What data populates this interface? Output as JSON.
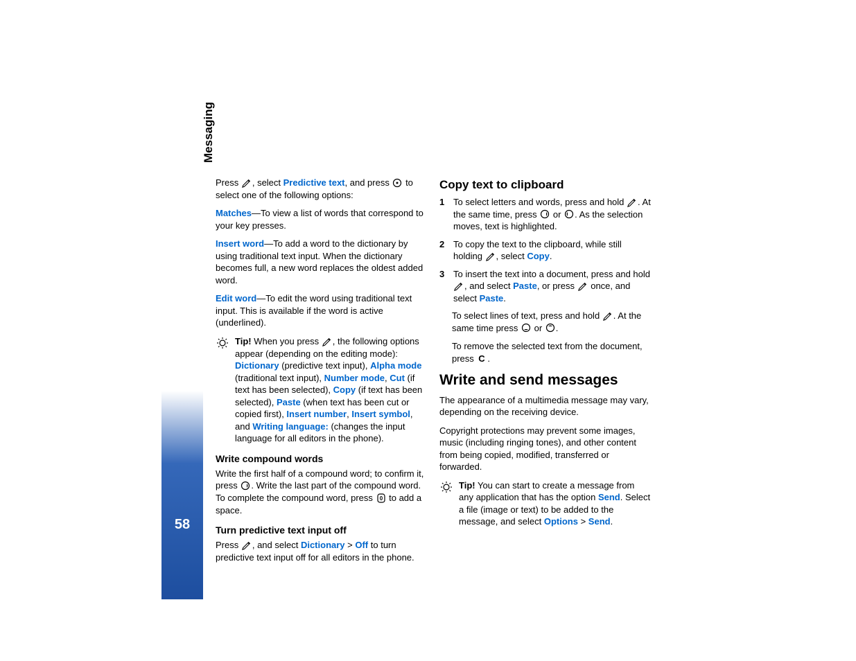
{
  "sidebar": {
    "section": "Messaging",
    "page_number": "58"
  },
  "col1": {
    "p1_a": "Press ",
    "p1_b": ", select ",
    "p1_link1": "Predictive text",
    "p1_c": ", and press ",
    "p1_d": " to select one of the following options:",
    "matches_label": "Matches",
    "matches_text": "—To view a list of words that correspond to your key presses.",
    "insert_word_label": "Insert word",
    "insert_word_text": "—To add a word to the dictionary by using traditional text input. When the dictionary becomes full, a new word replaces the oldest added word.",
    "edit_word_label": "Edit word",
    "edit_word_text": "—To edit the word using traditional text input. This is available if the word is active (underlined).",
    "tip_label": "Tip!",
    "tip1_a": " When you press ",
    "tip1_b": ", the following options appear (depending on the editing mode): ",
    "tip1_dict": "Dictionary",
    "tip1_c": " (predictive text input), ",
    "tip1_alpha": "Alpha mode",
    "tip1_d": " (traditional text input), ",
    "tip1_number": "Number mode",
    "tip1_sep1": ", ",
    "tip1_cut": "Cut",
    "tip1_e": " (if text has been selected), ",
    "tip1_copy": "Copy",
    "tip1_f": " (if text has been selected), ",
    "tip1_paste": "Paste",
    "tip1_g": " (when text has been cut or copied first), ",
    "tip1_insnum": "Insert number",
    "tip1_sep2": ", ",
    "tip1_inssym": "Insert symbol",
    "tip1_h": ", and ",
    "tip1_wlang": "Writing language:",
    "tip1_i": " (changes the input language for all editors in the phone).",
    "sub1": "Write compound words",
    "p2_a": "Write the first half of a compound word; to confirm it, press ",
    "p2_b": ". Write the last part of the compound word. To complete the compound word, press ",
    "p2_c": " to add a space.",
    "sub2": "Turn predictive text input off",
    "p3_a": "Press ",
    "p3_b": ", and select ",
    "p3_dict": "Dictionary",
    "p3_gt": " > ",
    "p3_off": "Off",
    "p3_c": " to turn predictive text input off for all editors in the phone."
  },
  "col2": {
    "h2": "Copy text to clipboard",
    "n1": "1",
    "li1_a": "To select letters and words, press and hold ",
    "li1_b": ". At the same time, press ",
    "li1_c": " or ",
    "li1_d": ". As the selection moves, text is highlighted.",
    "n2": "2",
    "li2_a": "To copy the text to the clipboard, while still holding ",
    "li2_b": ", select ",
    "li2_copy": "Copy",
    "li2_c": ".",
    "n3": "3",
    "li3_a": "To insert the text into a document, press and hold ",
    "li3_b": ", and select ",
    "li3_paste": "Paste",
    "li3_c": ", or press ",
    "li3_d": " once, and select ",
    "li3_paste2": "Paste",
    "li3_e": ".",
    "p4_a": "To select lines of text, press and hold ",
    "p4_b": ". At the same time press ",
    "p4_c": " or ",
    "p4_d": ".",
    "p5_a": "To remove the selected text from the document, press ",
    "p5_b": ".",
    "h1": "Write and send messages",
    "p6": "The appearance of a multimedia message may vary, depending on the receiving device.",
    "p7": "Copyright protections may prevent some images, music (including ringing tones), and other content from being copied, modified, transferred or forwarded.",
    "tip_label": "Tip!",
    "tip2_a": " You can start to create a message from any application that has the option ",
    "tip2_send": "Send",
    "tip2_b": ". Select a file (image or text) to be added to the message, and select ",
    "tip2_options": "Options",
    "tip2_gt": " > ",
    "tip2_send2": "Send",
    "tip2_c": "."
  }
}
